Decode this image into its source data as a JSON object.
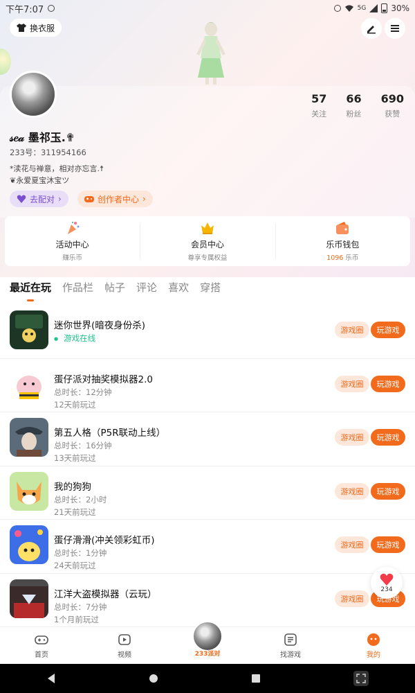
{
  "status": {
    "time": "下午7:07",
    "battery": "30%",
    "net": "5G"
  },
  "header": {
    "outfit_label": "换衣服"
  },
  "profile": {
    "name": "𝓈𝑒𝒶 墨祁玉.✟",
    "uid": "233号：311954166",
    "bio_line1": "*渎花与禅意，相对亦忘言.☨",
    "bio_line2": "❦永爱夏宝沐宝ツ",
    "stats": [
      {
        "num": "57",
        "label": "关注"
      },
      {
        "num": "66",
        "label": "粉丝"
      },
      {
        "num": "690",
        "label": "获赞"
      }
    ],
    "pair_label": "去配对",
    "creator_label": "创作者中心"
  },
  "quick": [
    {
      "title": "活动中心",
      "sub": "赚乐币"
    },
    {
      "title": "会员中心",
      "sub": "尊享专属权益"
    },
    {
      "title": "乐币钱包",
      "sub_num": "1096",
      "sub_unit": " 乐币"
    }
  ],
  "tabs": [
    "最近在玩",
    "作品栏",
    "帖子",
    "评论",
    "喜欢",
    "穿搭"
  ],
  "buttons": {
    "circle": "游戏圈",
    "play": "玩游戏"
  },
  "games": [
    {
      "title": "迷你世界(暗夜身份杀)",
      "line2": "游戏在线",
      "line3": ""
    },
    {
      "title": "蛋仔派对抽奖模拟器2.0",
      "line2": "总时长：12分钟",
      "line3": "12天前玩过"
    },
    {
      "title": "第五人格（P5R联动上线）",
      "line2": "总时长：16分钟",
      "line3": "13天前玩过"
    },
    {
      "title": "我的狗狗",
      "line2": "总时长：2小时",
      "line3": "21天前玩过"
    },
    {
      "title": "蛋仔滑滑(冲关领彩虹币)",
      "line2": "总时长：1分钟",
      "line3": "24天前玩过"
    },
    {
      "title": "江洋大盗模拟器（云玩）",
      "line2": "总时长：7分钟",
      "line3": "1个月前玩过"
    }
  ],
  "float_count": "234",
  "nav": {
    "home": "首页",
    "video": "视频",
    "center": "233派对",
    "find": "找游戏",
    "me": "我的"
  },
  "colors": {
    "accent": "#f26a1b",
    "online": "#1ec38a",
    "pair": "#7a4fd0"
  }
}
